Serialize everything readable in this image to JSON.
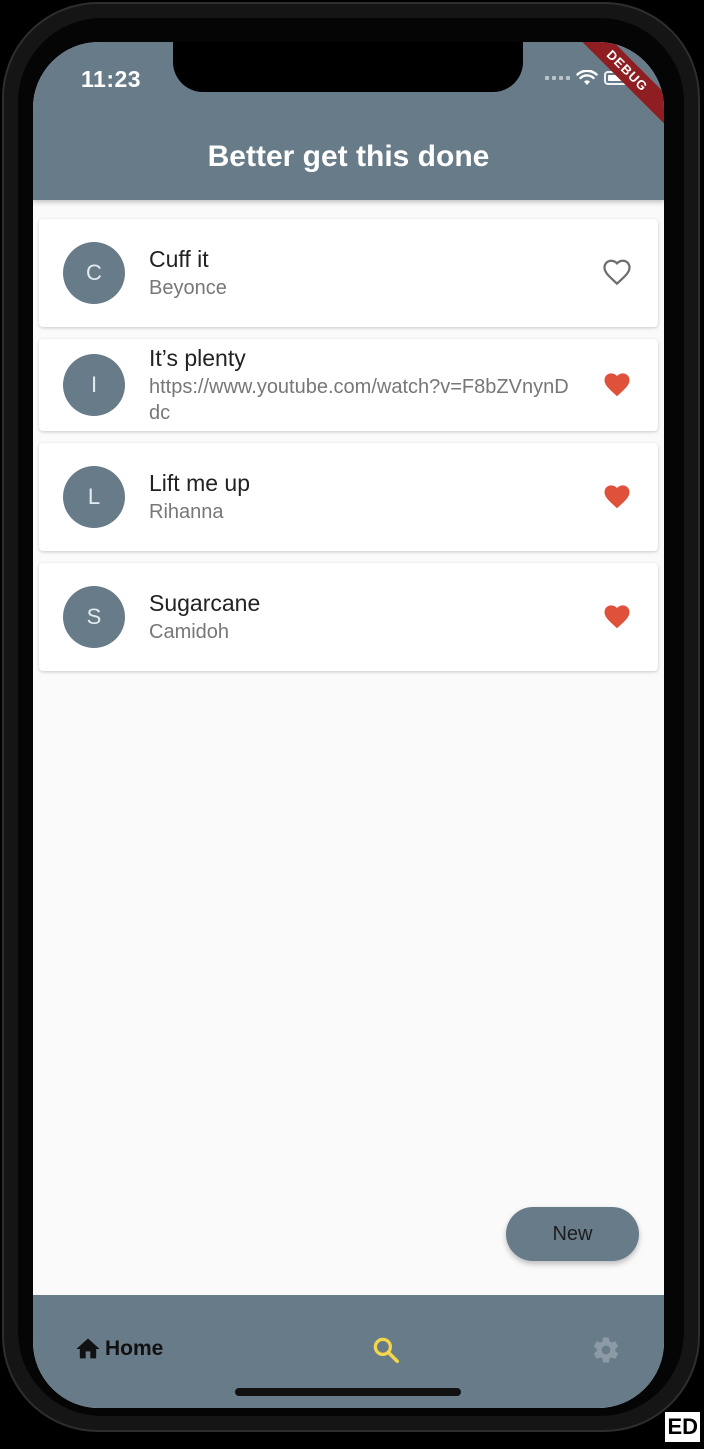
{
  "status_bar": {
    "time": "11:23"
  },
  "debug_banner": "DEBUG",
  "app_bar": {
    "title": "Better get this done"
  },
  "songs": [
    {
      "initial": "C",
      "title": "Cuff it",
      "subtitle": "Beyonce",
      "favorite": false
    },
    {
      "initial": "I",
      "title": "It’s plenty",
      "subtitle": "https://www.youtube.com/watch?v=F8bZVnynDdc",
      "favorite": true
    },
    {
      "initial": "L",
      "title": "Lift me up",
      "subtitle": "Rihanna",
      "favorite": true
    },
    {
      "initial": "S",
      "title": "Sugarcane",
      "subtitle": "Camidoh",
      "favorite": true
    }
  ],
  "fab": {
    "label": "New"
  },
  "bottom_nav": {
    "home_label": "Home",
    "home_icon": "home-icon",
    "search_icon": "search-icon",
    "settings_icon": "gear-icon"
  },
  "corner_text": "ED",
  "colors": {
    "primary": "#687b88",
    "favorite": "#e0513b",
    "search_active": "#f5d54a",
    "settings_inactive": "#8b9aa5"
  }
}
